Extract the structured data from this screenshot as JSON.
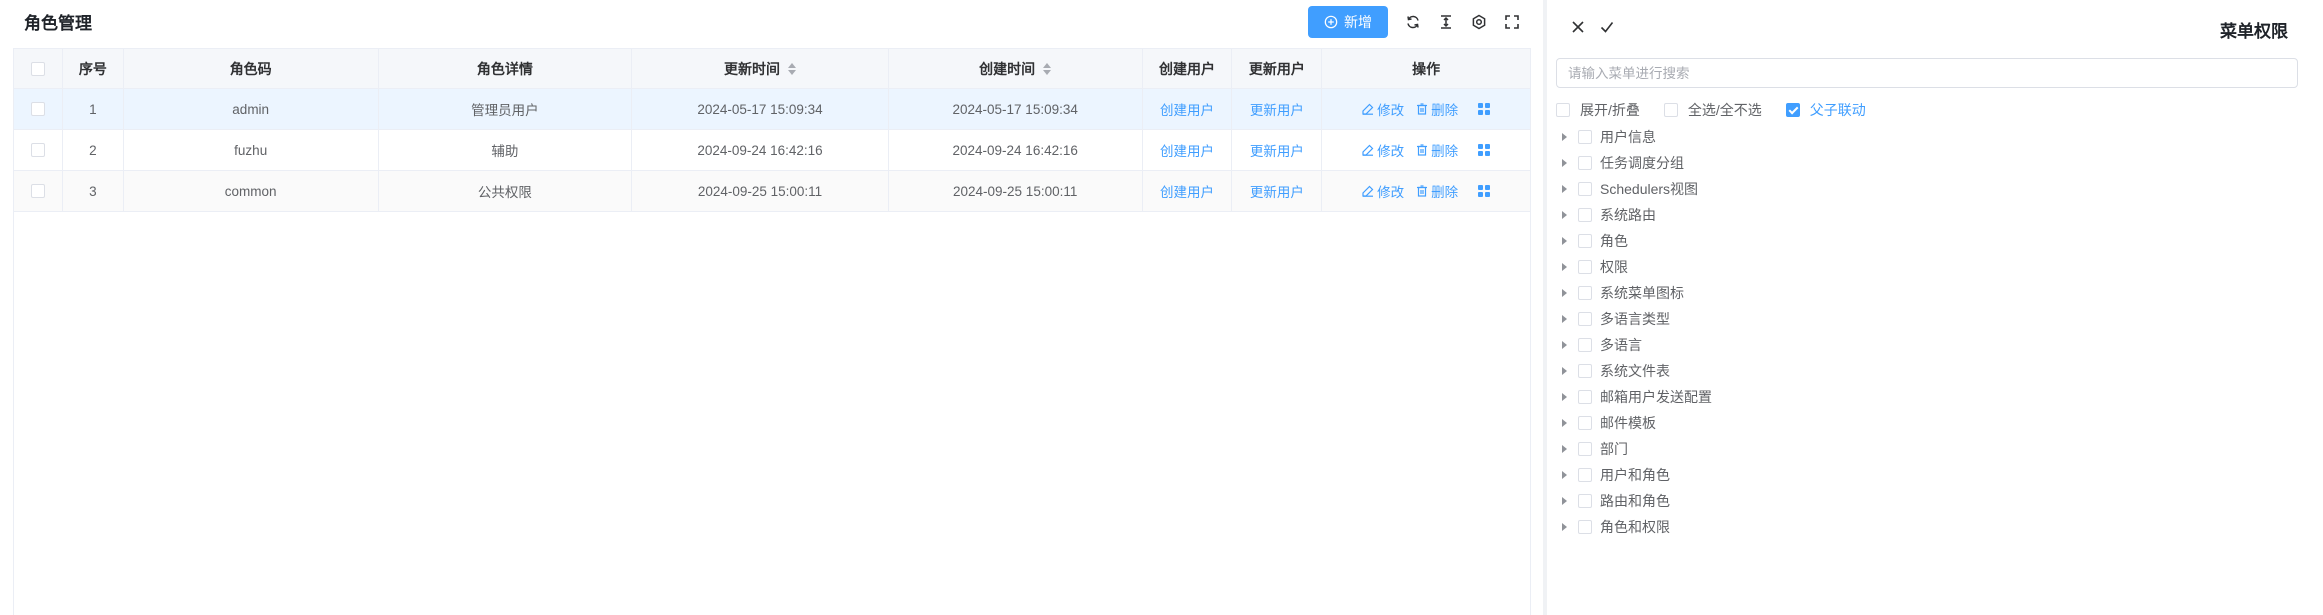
{
  "header": {
    "title": "角色管理",
    "add_label": "新增"
  },
  "table": {
    "columns": [
      "序号",
      "角色码",
      "角色详情",
      "更新时间",
      "创建时间",
      "创建用户",
      "更新用户",
      "操作"
    ],
    "rows": [
      {
        "index": "1",
        "code": "admin",
        "detail": "管理员用户",
        "updated": "2024-05-17 15:09:34",
        "created": "2024-05-17 15:09:34",
        "create_user": "创建用户",
        "update_user": "更新用户"
      },
      {
        "index": "2",
        "code": "fuzhu",
        "detail": "辅助",
        "updated": "2024-09-24 16:42:16",
        "created": "2024-09-24 16:42:16",
        "create_user": "创建用户",
        "update_user": "更新用户"
      },
      {
        "index": "3",
        "code": "common",
        "detail": "公共权限",
        "updated": "2024-09-25 15:00:11",
        "created": "2024-09-25 15:00:11",
        "create_user": "创建用户",
        "update_user": "更新用户"
      }
    ],
    "edit_label": "修改",
    "delete_label": "删除"
  },
  "drawer": {
    "title": "菜单权限",
    "search_placeholder": "请输入菜单进行搜索",
    "options": {
      "expand": "展开/折叠",
      "select_all": "全选/全不选",
      "linkage": "父子联动"
    },
    "tree": [
      "用户信息",
      "任务调度分组",
      "Schedulers视图",
      "系统路由",
      "角色",
      "权限",
      "系统菜单图标",
      "多语言类型",
      "多语言",
      "系统文件表",
      "邮箱用户发送配置",
      "邮件模板",
      "部门",
      "用户和角色",
      "路由和角色",
      "角色和权限"
    ]
  },
  "colors": {
    "primary": "#409eff",
    "selected_row": "#ecf5ff",
    "border": "#ebeef5"
  }
}
